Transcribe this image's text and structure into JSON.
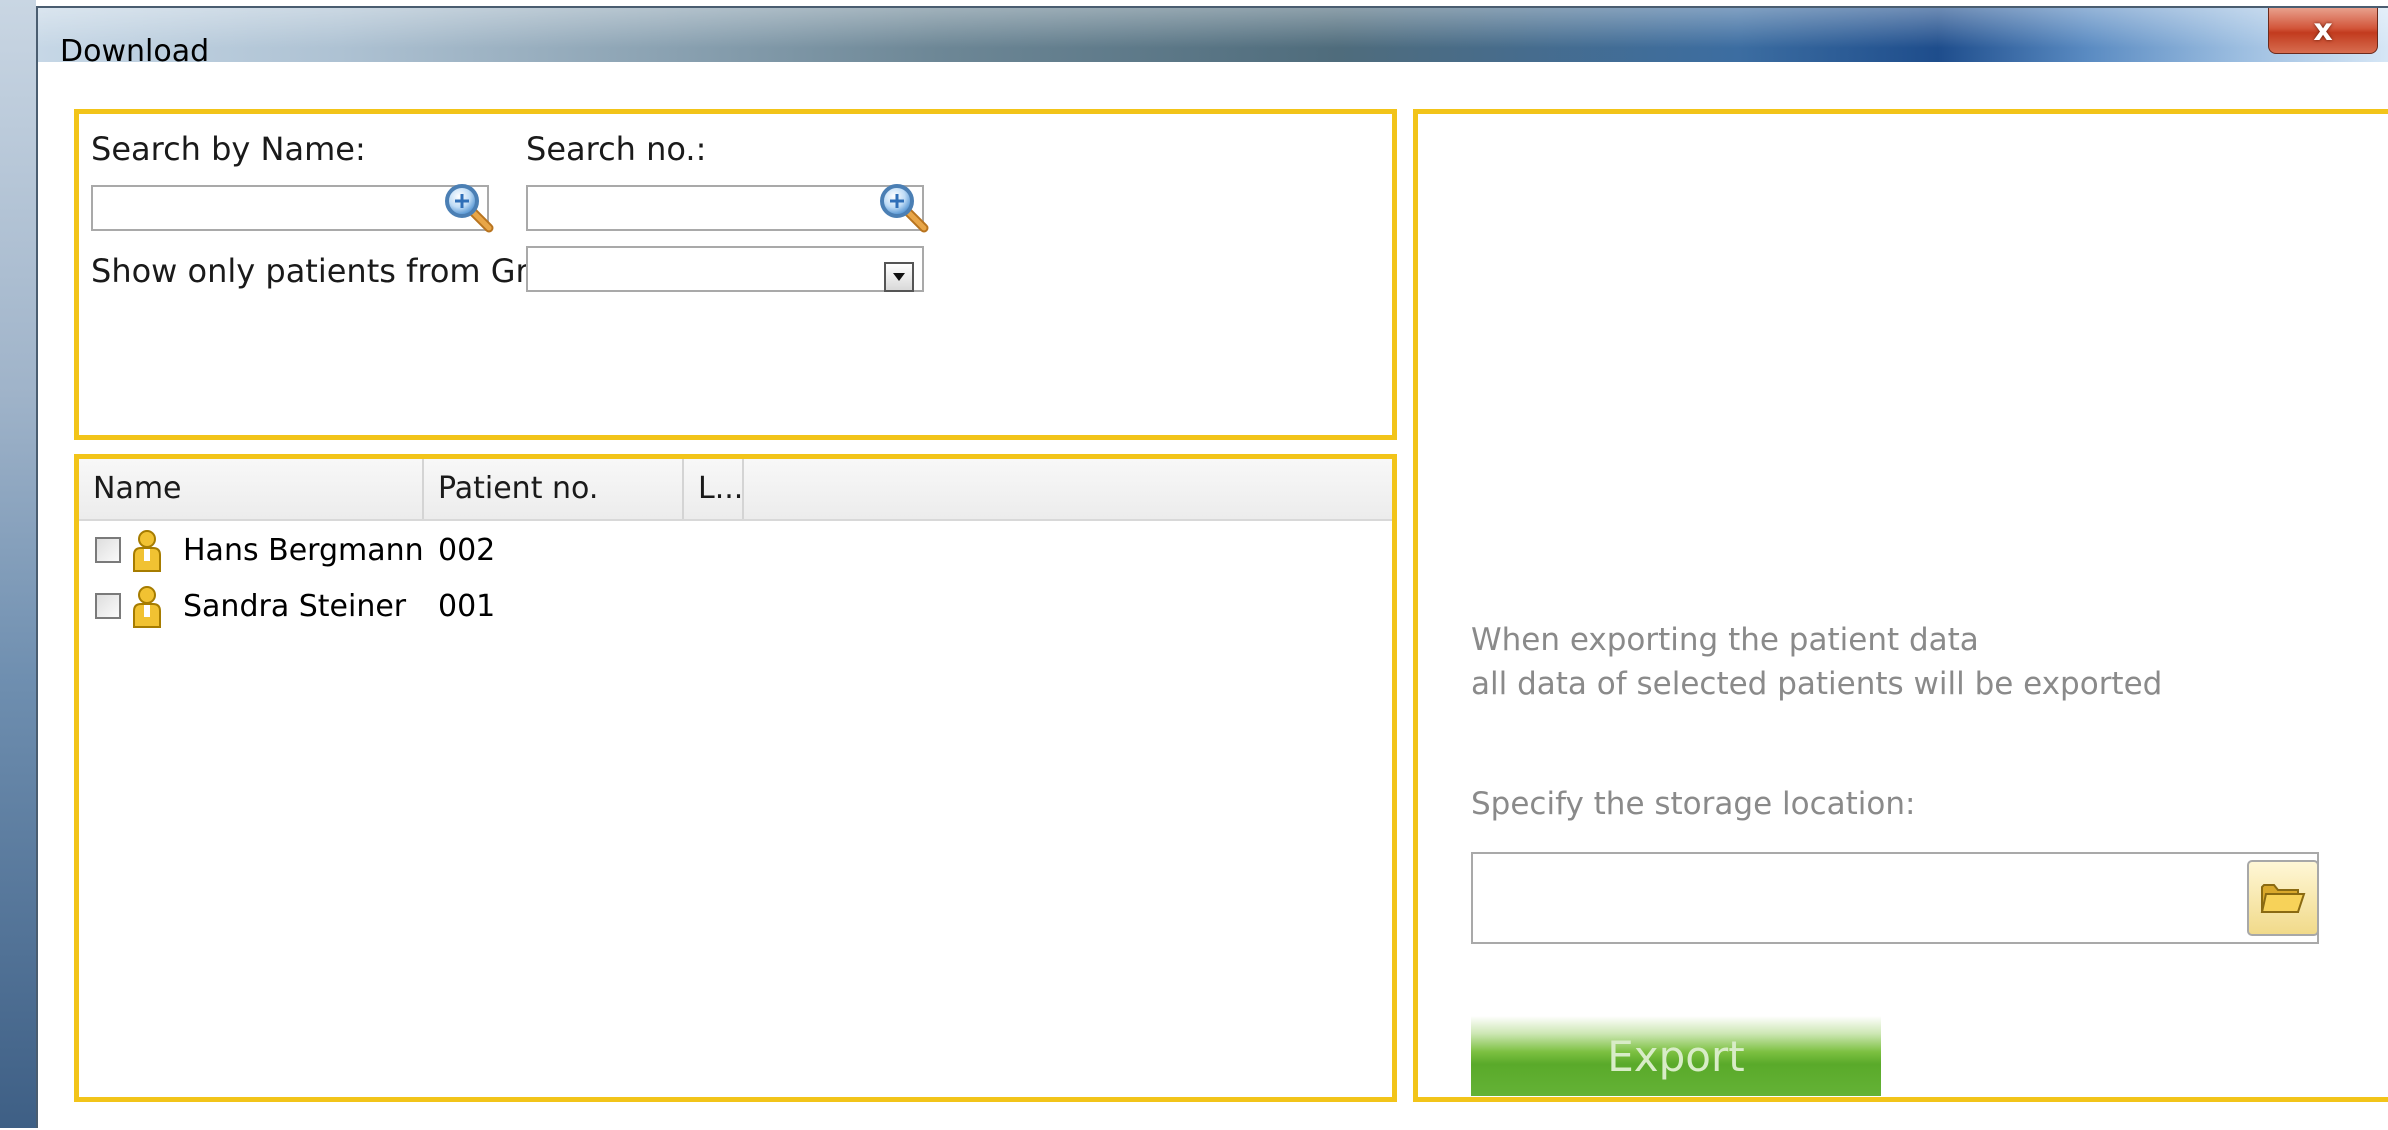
{
  "window": {
    "title": "Download",
    "close_label": "x"
  },
  "search": {
    "name_label": "Search by Name:",
    "name_value": "",
    "number_label": "Search no.:",
    "number_value": "",
    "group_label": "Show only patients from Group:",
    "group_selected": ""
  },
  "table": {
    "columns": [
      "Name",
      "Patient no.",
      "L..."
    ],
    "rows": [
      {
        "name": "Hans Bergmann",
        "patient_no": "002",
        "checked": false
      },
      {
        "name": "Sandra Steiner",
        "patient_no": "001",
        "checked": false
      }
    ]
  },
  "export": {
    "info_line_1": "When exporting the patient data",
    "info_line_2": "all data of selected patients will be exported",
    "storage_label": "Specify the storage location:",
    "storage_value": "",
    "button_label": "Export"
  },
  "icons": {
    "search": "search-icon",
    "dropdown": "chevron-down-icon",
    "patient": "person-icon",
    "folder": "folder-open-icon",
    "close": "close-icon"
  },
  "colors": {
    "panel_border": "#f2c419",
    "export_button": "#5aaa2a",
    "close_button": "#c23b1e"
  }
}
